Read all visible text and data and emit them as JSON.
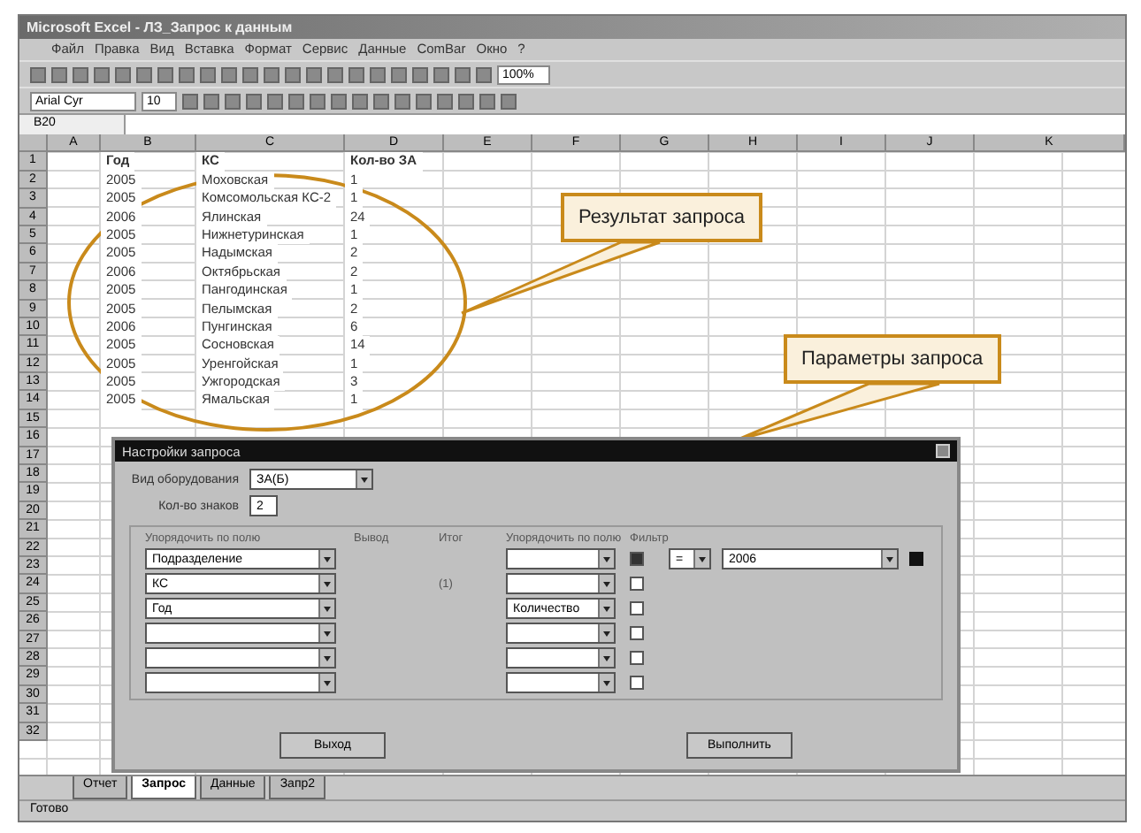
{
  "window": {
    "title": "Microsoft Excel - ЛЗ_Запрос к данным"
  },
  "menu": [
    "Файл",
    "Правка",
    "Вид",
    "Вставка",
    "Формат",
    "Сервис",
    "Данные",
    "ComBar",
    "Окно",
    "?"
  ],
  "toolbar": {
    "zoom": "100%",
    "font": "Arial Cyr",
    "font_size": "10"
  },
  "formula_bar": {
    "cell": "B20"
  },
  "columns": [
    "A",
    "B",
    "C",
    "D",
    "E",
    "F",
    "G",
    "H",
    "I",
    "J",
    "K"
  ],
  "table": {
    "headers": [
      "Год",
      "КС",
      "Кол-во ЗА"
    ],
    "rows": [
      [
        "2005",
        "Моховская",
        "1"
      ],
      [
        "2005",
        "Комсомольская КС-2",
        "1"
      ],
      [
        "2006",
        "Ялинская",
        "24"
      ],
      [
        "2005",
        "Нижнетуринская",
        "1"
      ],
      [
        "2005",
        "Надымская",
        "2"
      ],
      [
        "2006",
        "Октябрьская",
        "2"
      ],
      [
        "2005",
        "Пангодинская",
        "1"
      ],
      [
        "2005",
        "Пелымская",
        "2"
      ],
      [
        "2006",
        "Пунгинская",
        "6"
      ],
      [
        "2005",
        "Сосновская",
        "14"
      ],
      [
        "2005",
        "Уренгойская",
        "1"
      ],
      [
        "2005",
        "Ужгородская",
        "3"
      ],
      [
        "2005",
        "Ямальская",
        "1"
      ]
    ]
  },
  "row_numbers": [
    "1",
    "2",
    "3",
    "4",
    "5",
    "6",
    "7",
    "8",
    "9",
    "10",
    "11",
    "12",
    "13",
    "14",
    "15",
    "16",
    "17",
    "18",
    "19",
    "20",
    "21",
    "22",
    "23",
    "24",
    "25",
    "26",
    "27",
    "28",
    "29",
    "30",
    "31",
    "32"
  ],
  "callouts": [
    {
      "text": "Результат запроса"
    },
    {
      "text": "Параметры запроса"
    }
  ],
  "dialog": {
    "title": "Настройки запроса",
    "equipment_label": "Вид оборудования",
    "equipment_value": "ЗА(Б)",
    "digits_label": "Кол-во знаков",
    "digits_value": "2",
    "group_headers": [
      "Упорядочить по полю",
      "Вывод",
      "Итог",
      "Упорядочить по полю",
      "Фильтр"
    ],
    "rows": [
      {
        "field": "Подразделение",
        "sort": "",
        "checked": true,
        "operator": "=",
        "value": "2006"
      },
      {
        "field": "КС",
        "marker": "(1)",
        "sort": "",
        "checked": false
      },
      {
        "field": "Год",
        "sort": "Количество",
        "checked": false
      },
      {
        "field": "",
        "sort": "",
        "checked": false
      },
      {
        "field": "",
        "sort": "",
        "checked": false
      },
      {
        "field": "",
        "sort": "",
        "checked": false
      }
    ],
    "buttons": [
      "Выход",
      "Выполнить"
    ]
  },
  "sheet_tabs": [
    {
      "label": "Отчет",
      "selected": false
    },
    {
      "label": "Запрос",
      "selected": true
    },
    {
      "label": "Данные",
      "selected": false
    },
    {
      "label": "Запр2",
      "selected": false
    }
  ],
  "status_bar": {
    "text": "Готово"
  }
}
